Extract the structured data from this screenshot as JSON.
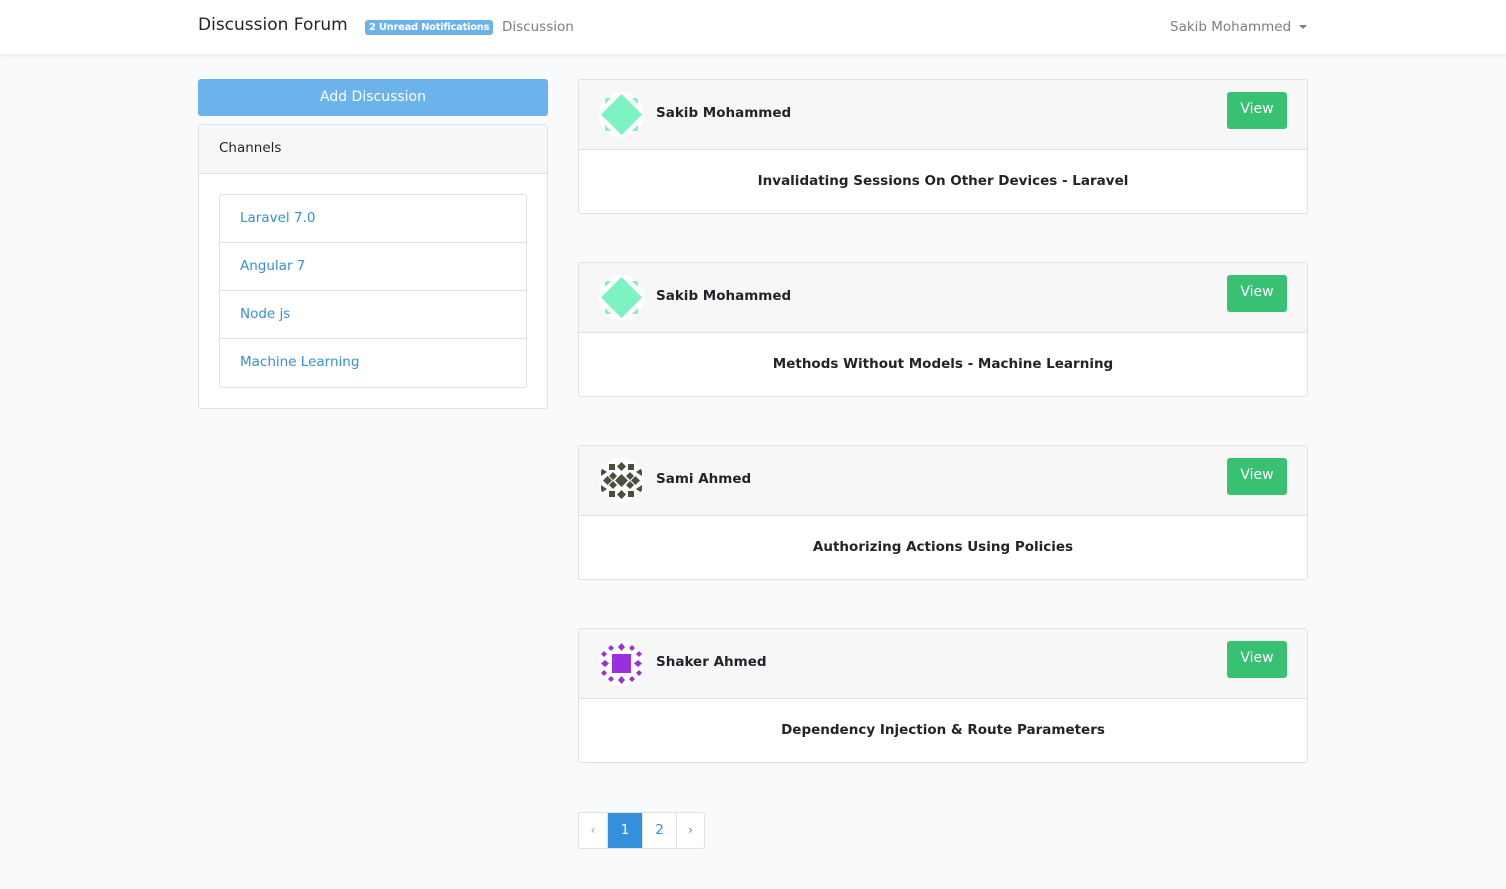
{
  "navbar": {
    "brand": "Discussion Forum",
    "notifications_badge": "2 Unread Notifications",
    "discussion_link": "Discussion",
    "user_name": "Sakib Mohammed"
  },
  "sidebar": {
    "add_button": "Add Discussion",
    "channels_title": "Channels",
    "channels": [
      {
        "label": "Laravel 7.0"
      },
      {
        "label": "Angular 7"
      },
      {
        "label": "Node js"
      },
      {
        "label": "Machine Learning"
      }
    ]
  },
  "discussions": [
    {
      "author": "Sakib Mohammed",
      "title": "Invalidating Sessions On Other Devices - Laravel",
      "view_label": "View",
      "avatar_icon": "green-diamond-identicon",
      "avatar_color": "#7ef3c2"
    },
    {
      "author": "Sakib Mohammed",
      "title": "Methods Without Models - Machine Learning",
      "view_label": "View",
      "avatar_icon": "green-diamond-identicon",
      "avatar_color": "#7ef3c2"
    },
    {
      "author": "Sami Ahmed",
      "title": "Authorizing Actions Using Policies",
      "view_label": "View",
      "avatar_icon": "olive-pattern-identicon",
      "avatar_color": "#4b4f3e"
    },
    {
      "author": "Shaker Ahmed",
      "title": "Dependency Injection & Route Parameters",
      "view_label": "View",
      "avatar_icon": "purple-square-identicon",
      "avatar_color": "#9b2fe0"
    }
  ],
  "pagination": {
    "prev": "‹",
    "pages": [
      "1",
      "2"
    ],
    "current": "1",
    "next": "›"
  },
  "colors": {
    "primary": "#3490dc",
    "info": "#6cb2eb",
    "success": "#38c172",
    "background": "#f8fafc"
  }
}
